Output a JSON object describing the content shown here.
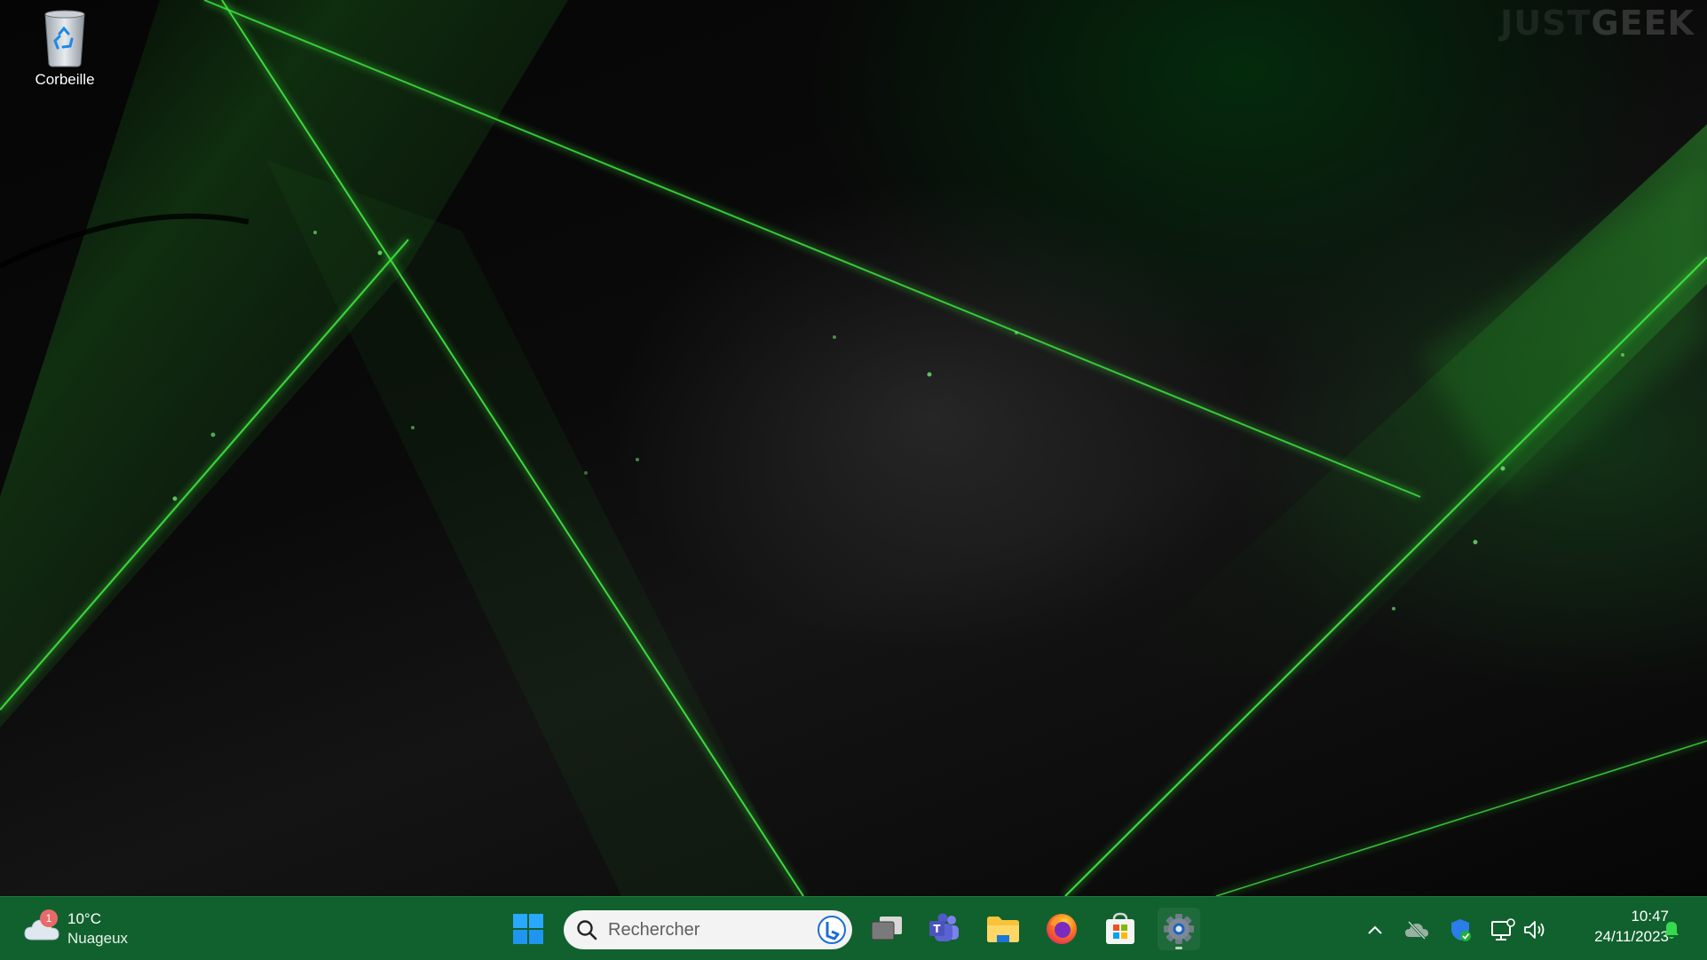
{
  "desktop": {
    "icons": [
      {
        "label": "Corbeille",
        "icon": "recycle-bin-icon"
      }
    ],
    "watermark": {
      "part1": "JUST",
      "part2": "GEEK"
    }
  },
  "taskbar": {
    "weather": {
      "badge_count": "1",
      "temperature": "10°C",
      "condition": "Nuageux",
      "icon": "cloud-icon"
    },
    "search": {
      "placeholder": "Rechercher"
    },
    "pinned_apps": [
      {
        "name": "start",
        "icon": "windows-logo-icon"
      },
      {
        "name": "task-view",
        "icon": "task-view-icon"
      },
      {
        "name": "teams",
        "icon": "teams-icon"
      },
      {
        "name": "file-explorer",
        "icon": "folder-icon"
      },
      {
        "name": "firefox",
        "icon": "firefox-icon"
      },
      {
        "name": "microsoft-store",
        "icon": "store-icon"
      },
      {
        "name": "settings",
        "icon": "gear-icon",
        "active": true
      }
    ],
    "tray": {
      "icons": [
        "chevron-up-icon",
        "onedrive-offline-icon",
        "windows-security-icon",
        "network-icon",
        "volume-icon",
        "notification-bell-icon"
      ]
    },
    "clock": {
      "time": "10:47",
      "date": "24/11/2023"
    }
  },
  "colors": {
    "taskbar": "#11612e",
    "accent_green": "#39d639",
    "search_bg": "#f3f3f3"
  }
}
